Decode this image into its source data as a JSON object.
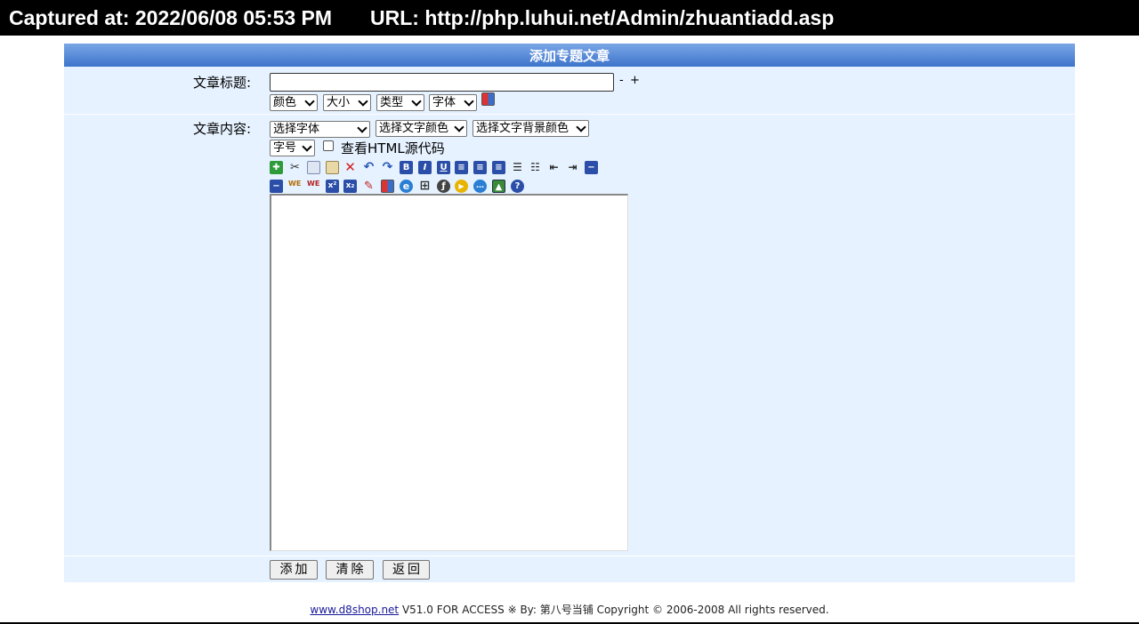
{
  "capture": {
    "captured_at": "Captured at: 2022/06/08 05:53 PM",
    "url": "URL: http://php.luhui.net/Admin/zhuantiadd.asp"
  },
  "form": {
    "header": "添加专题文章",
    "title_label": "文章标题:",
    "title_value": "",
    "minus": "-",
    "plus": "+",
    "title_selects": {
      "color": "颜色",
      "size": "大小",
      "type": "类型",
      "font": "字体"
    },
    "content_label": "文章内容:",
    "editor_selects": {
      "font": "选择字体",
      "text_color": "选择文字颜色",
      "bg_color": "选择文字背景颜色",
      "font_size": "字号"
    },
    "html_source_label": "查看HTML源代码",
    "html_source_checked": false,
    "toolbar_row1": [
      "select-all-icon",
      "cut-icon",
      "copy-icon",
      "paste-icon",
      "delete-icon",
      "undo-icon",
      "redo-icon",
      "bold-icon",
      "italic-icon",
      "underline-icon",
      "align-left-icon",
      "align-center-icon",
      "align-right-icon",
      "unordered-list-icon",
      "ordered-list-icon",
      "outdent-icon",
      "indent-icon",
      "separator-icon"
    ],
    "toolbar_row2": [
      "separator-icon",
      "link-icon",
      "unlink-icon",
      "superscript-icon",
      "subscript-icon",
      "highlight-icon",
      "color-picker-icon",
      "web-icon",
      "table-icon",
      "flash-icon",
      "media-icon",
      "comment-icon",
      "image-icon",
      "help-icon"
    ],
    "buttons": {
      "add": "添加",
      "clear": "清除",
      "back": "返回"
    }
  },
  "footer": {
    "link": "www.d8shop.net",
    "text": " V51.0 FOR ACCESS ※ By: 第八号当铺 Copyright © 2006-2008 All rights reserved."
  },
  "colors": {
    "panel_bg": "#e6f2ff",
    "header_top": "#7aa6e6",
    "header_bottom": "#3d74cc"
  }
}
